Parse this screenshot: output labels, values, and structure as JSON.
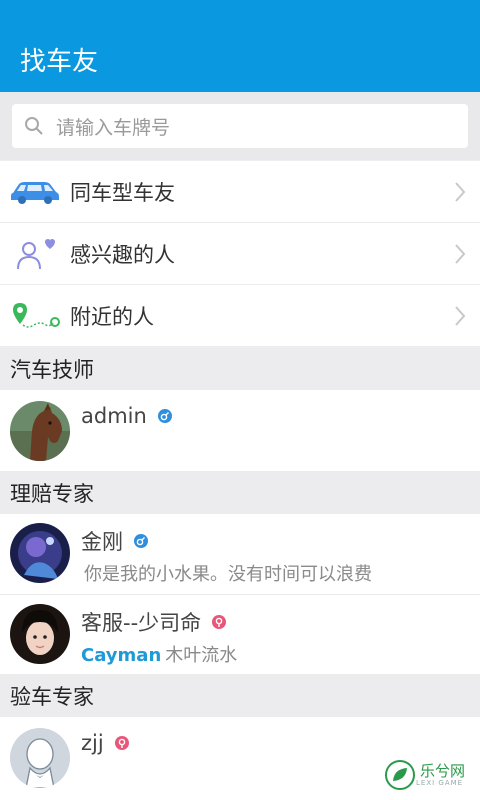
{
  "app_bar": {
    "title": "找车友"
  },
  "search": {
    "placeholder": "请输入车牌号"
  },
  "menu": [
    {
      "label": "同车型车友",
      "icon": "car-icon"
    },
    {
      "label": "感兴趣的人",
      "icon": "heart-person-icon"
    },
    {
      "label": "附近的人",
      "icon": "location-route-icon"
    }
  ],
  "sections": [
    {
      "title": "汽车技师"
    },
    {
      "title": "理赔专家"
    },
    {
      "title": "验车专家"
    }
  ],
  "contacts": [
    {
      "name": "admin",
      "gender": "male"
    },
    {
      "name": "金刚",
      "gender": "male",
      "subtitle": "你是我的小水果。没有时间可以浪费"
    },
    {
      "name": "客服--少司命",
      "gender": "female",
      "subtitle_highlight": "Cayman",
      "subtitle": "木叶流水"
    },
    {
      "name": "zjj",
      "gender": "female"
    }
  ],
  "watermark": {
    "text": "乐兮网",
    "sub": "LEXI GAME"
  },
  "colors": {
    "primary": "#0a98e0",
    "male": "#2f8fde",
    "female": "#e8577a",
    "highlight": "#1e9ad6"
  }
}
